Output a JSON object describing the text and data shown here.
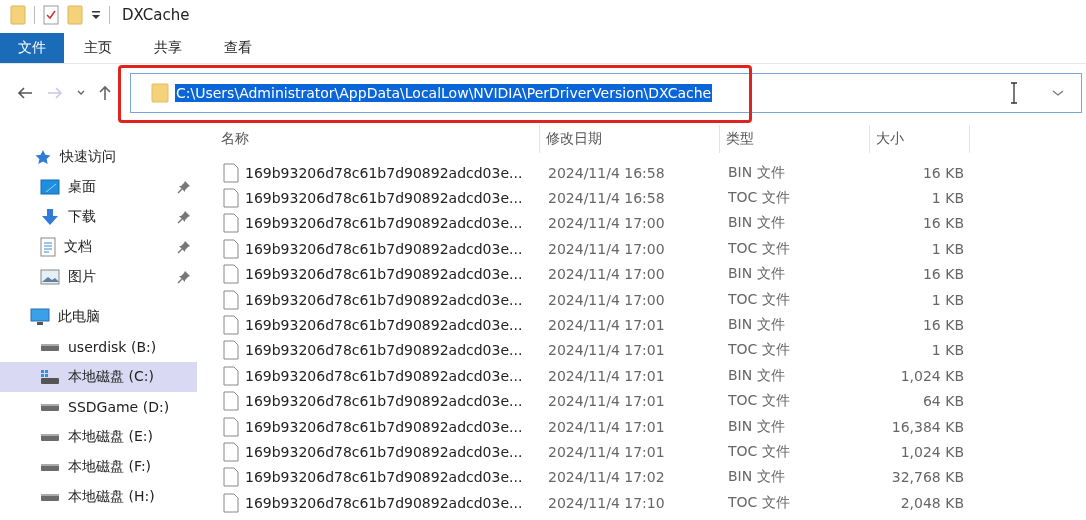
{
  "window": {
    "title": "DXCache"
  },
  "ribbon_tabs": [
    {
      "label": "文件",
      "selected": true
    },
    {
      "label": "主页",
      "selected": false
    },
    {
      "label": "共享",
      "selected": false
    },
    {
      "label": "查看",
      "selected": false
    }
  ],
  "nav": {
    "forward_disabled": true
  },
  "address": {
    "value": "C:\\Users\\Administrator\\AppData\\LocalLow\\NVIDIA\\PerDriverVersion\\DXCache",
    "selected": true,
    "annotated": true
  },
  "sidebar": {
    "items": [
      {
        "kind": "star",
        "label": "快速访问",
        "selected": false,
        "children": [
          {
            "kind": "desktop",
            "label": "桌面",
            "selected": false,
            "pinned": true
          },
          {
            "kind": "download",
            "label": "下载",
            "selected": false,
            "pinned": true
          },
          {
            "kind": "document",
            "label": "文档",
            "selected": false,
            "pinned": true
          },
          {
            "kind": "image",
            "label": "图片",
            "selected": false,
            "pinned": true
          }
        ]
      },
      {
        "kind": "pc",
        "label": "此电脑",
        "selected": false,
        "children": [
          {
            "kind": "drive",
            "label": "userdisk (B:)",
            "selected": false,
            "pinned": false
          },
          {
            "kind": "system-drive",
            "label": "本地磁盘 (C:)",
            "selected": true,
            "pinned": false
          },
          {
            "kind": "drive",
            "label": "SSDGame (D:)",
            "selected": false,
            "pinned": false
          },
          {
            "kind": "drive",
            "label": "本地磁盘 (E:)",
            "selected": false,
            "pinned": false
          },
          {
            "kind": "drive",
            "label": "本地磁盘 (F:)",
            "selected": false,
            "pinned": false
          },
          {
            "kind": "drive",
            "label": "本地磁盘 (H:)",
            "selected": false,
            "pinned": false
          }
        ]
      }
    ]
  },
  "table": {
    "columns": [
      "名称",
      "修改日期",
      "类型",
      "大小"
    ],
    "rows": [
      {
        "name": "169b93206d78c61b7d90892adcd03e...",
        "date": "2024/11/4 16:58",
        "type": "BIN 文件",
        "size": "16 KB"
      },
      {
        "name": "169b93206d78c61b7d90892adcd03e...",
        "date": "2024/11/4 16:58",
        "type": "TOC 文件",
        "size": "1 KB"
      },
      {
        "name": "169b93206d78c61b7d90892adcd03e...",
        "date": "2024/11/4 17:00",
        "type": "BIN 文件",
        "size": "16 KB"
      },
      {
        "name": "169b93206d78c61b7d90892adcd03e...",
        "date": "2024/11/4 17:00",
        "type": "TOC 文件",
        "size": "1 KB"
      },
      {
        "name": "169b93206d78c61b7d90892adcd03e...",
        "date": "2024/11/4 17:00",
        "type": "BIN 文件",
        "size": "16 KB"
      },
      {
        "name": "169b93206d78c61b7d90892adcd03e...",
        "date": "2024/11/4 17:00",
        "type": "TOC 文件",
        "size": "1 KB"
      },
      {
        "name": "169b93206d78c61b7d90892adcd03e...",
        "date": "2024/11/4 17:01",
        "type": "BIN 文件",
        "size": "16 KB"
      },
      {
        "name": "169b93206d78c61b7d90892adcd03e...",
        "date": "2024/11/4 17:01",
        "type": "TOC 文件",
        "size": "1 KB"
      },
      {
        "name": "169b93206d78c61b7d90892adcd03e...",
        "date": "2024/11/4 17:01",
        "type": "BIN 文件",
        "size": "1,024 KB"
      },
      {
        "name": "169b93206d78c61b7d90892adcd03e...",
        "date": "2024/11/4 17:01",
        "type": "TOC 文件",
        "size": "64 KB"
      },
      {
        "name": "169b93206d78c61b7d90892adcd03e...",
        "date": "2024/11/4 17:01",
        "type": "BIN 文件",
        "size": "16,384 KB"
      },
      {
        "name": "169b93206d78c61b7d90892adcd03e...",
        "date": "2024/11/4 17:01",
        "type": "TOC 文件",
        "size": "1,024 KB"
      },
      {
        "name": "169b93206d78c61b7d90892adcd03e...",
        "date": "2024/11/4 17:02",
        "type": "BIN 文件",
        "size": "32,768 KB"
      },
      {
        "name": "169b93206d78c61b7d90892adcd03e...",
        "date": "2024/11/4 17:10",
        "type": "TOC 文件",
        "size": "2,048 KB"
      }
    ]
  }
}
